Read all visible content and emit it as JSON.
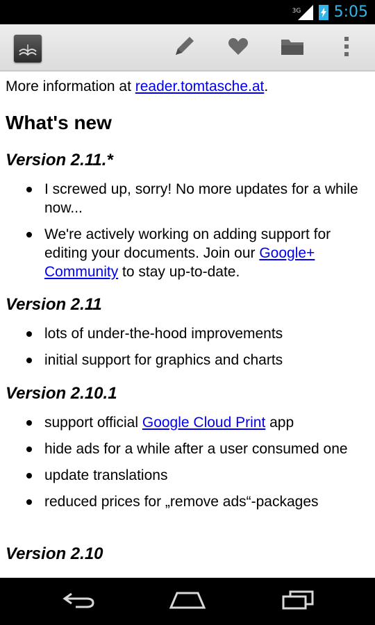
{
  "status_bar": {
    "network": "3G",
    "time": "5:05"
  },
  "content": {
    "intro_text": "More information at ",
    "intro_link": "reader.tomtasche.at",
    "intro_suffix": ".",
    "heading": "What's new",
    "versions": [
      {
        "title": "Version 2.11.*",
        "items": [
          {
            "text": "I screwed up, sorry! No more updates for a while now..."
          },
          {
            "before": "We're actively working on adding support for editing your documents. Join our ",
            "link": "Google+ Community",
            "after": " to stay up-to-date."
          }
        ]
      },
      {
        "title": "Version 2.11",
        "items": [
          {
            "text": "lots of under-the-hood improvements"
          },
          {
            "text": "initial support for graphics and charts"
          }
        ]
      },
      {
        "title": "Version 2.10.1",
        "items": [
          {
            "before": "support official ",
            "link": "Google Cloud Print",
            "after": " app"
          },
          {
            "text": "hide ads for a while after a user consumed one"
          },
          {
            "text": "update translations"
          },
          {
            "text": "reduced prices for „remove ads“-packages"
          }
        ]
      },
      {
        "title": "Version 2.10",
        "items": []
      }
    ]
  },
  "icons": {
    "app": "document-reader-app-icon",
    "edit": "pencil-icon",
    "favorite": "heart-icon",
    "open": "folder-icon",
    "overflow": "overflow-menu-icon",
    "back": "back-icon",
    "home": "home-icon",
    "recents": "recent-apps-icon"
  },
  "colors": {
    "accent": "#33b5e5",
    "link": "#0000ee"
  }
}
